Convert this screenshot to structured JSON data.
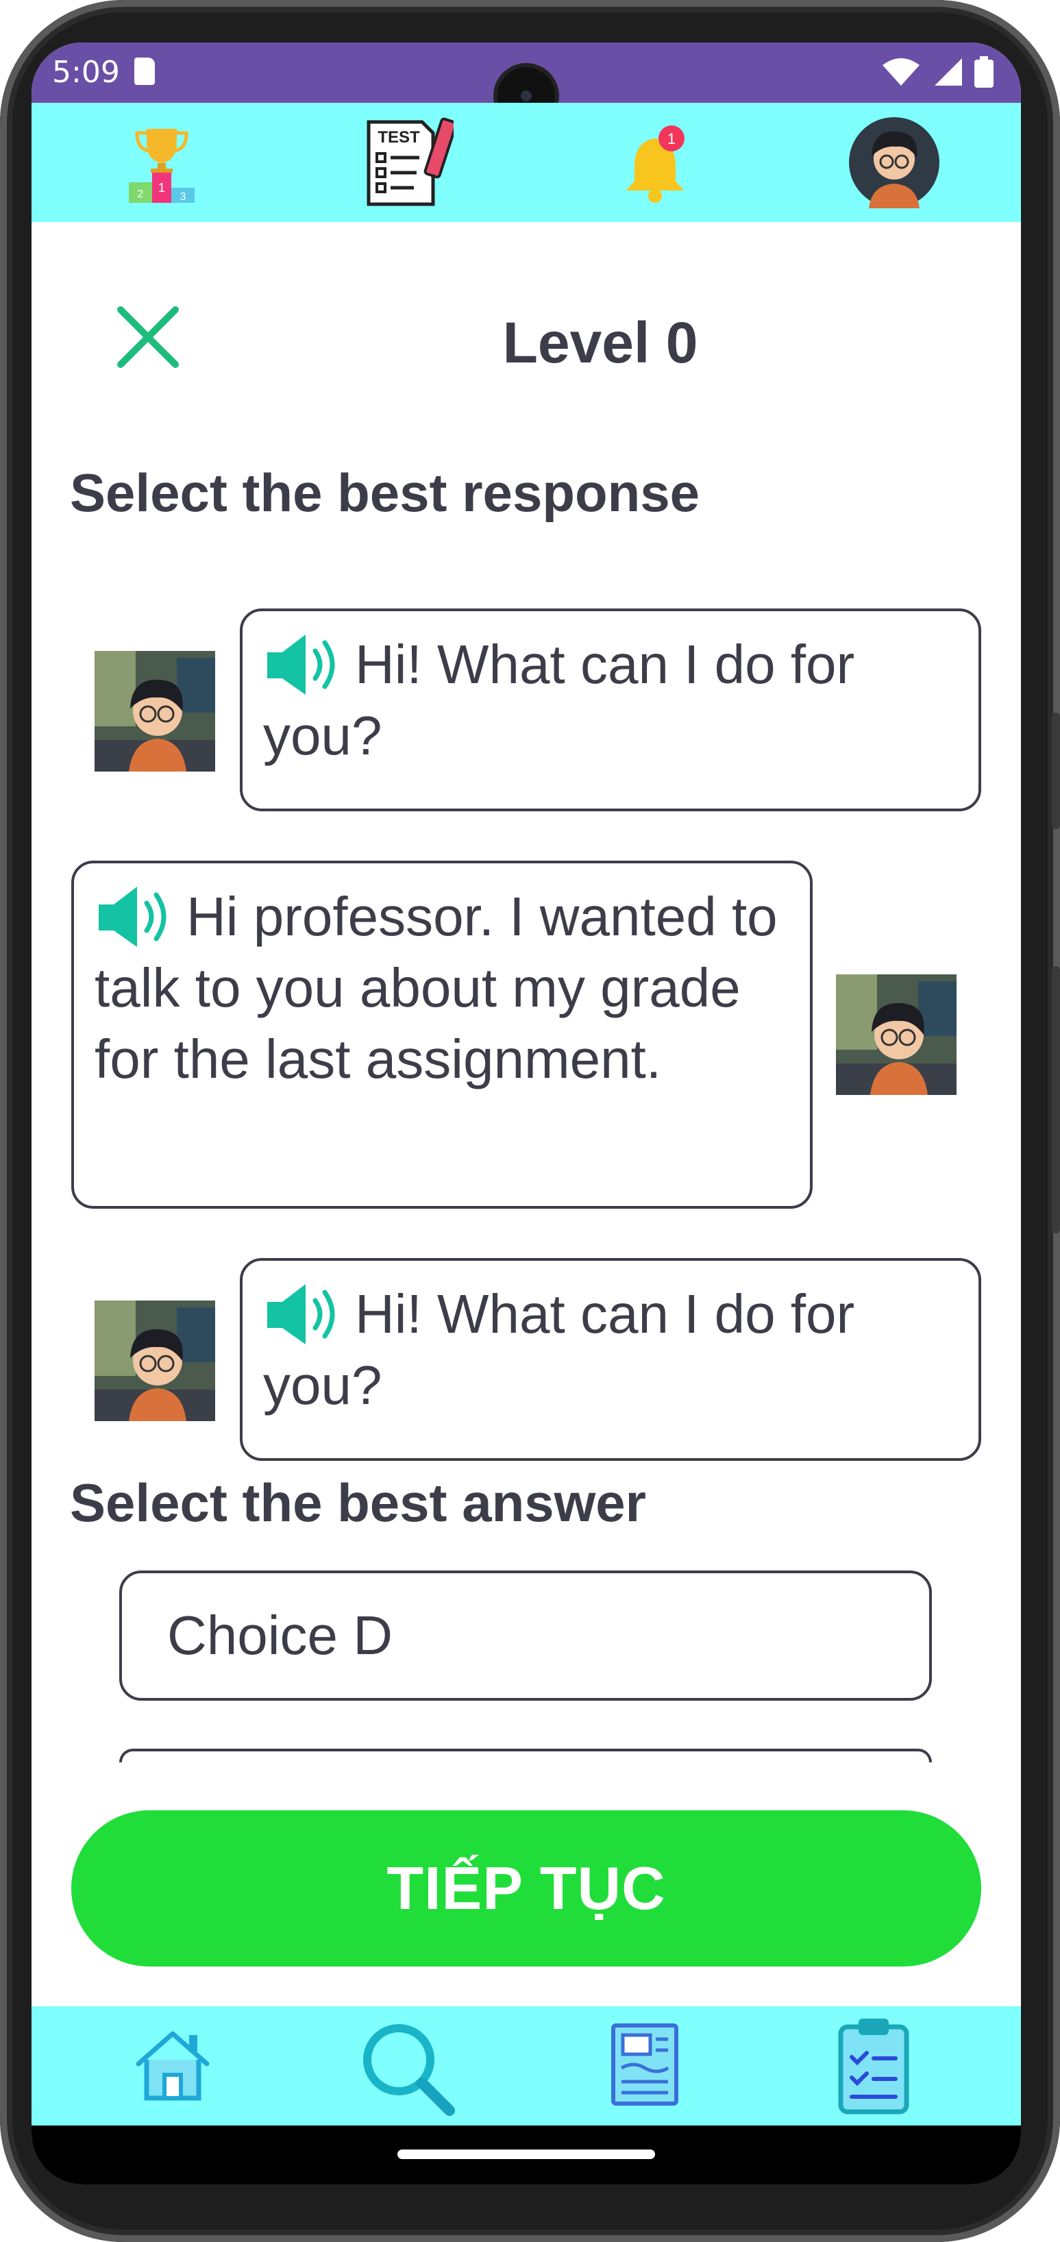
{
  "status_bar": {
    "time": "5:09",
    "icons": [
      "sim-card-icon",
      "wifi-icon",
      "signal-icon",
      "battery-icon"
    ],
    "color": "#6a4fa6"
  },
  "top_nav": {
    "items": [
      {
        "name": "leaderboard-icon"
      },
      {
        "name": "test-icon",
        "label": "TEST"
      },
      {
        "name": "notification-bell-icon",
        "badge": "1"
      },
      {
        "name": "profile-avatar"
      }
    ],
    "color": "#80ffff"
  },
  "header": {
    "title": "Level 0",
    "close_icon": "close-icon",
    "close_color": "#1ebc7c"
  },
  "question": {
    "prompt": "Select the best response",
    "messages": [
      {
        "side": "left",
        "text": "Hi! What can I do for you?"
      },
      {
        "side": "right",
        "text": "Hi professor. I wanted to talk to you about my grade for the last assignment."
      },
      {
        "side": "left",
        "text": "Hi! What can I do for you?"
      }
    ]
  },
  "answers": {
    "prompt": "Select the best answer",
    "choices": [
      "Choice D"
    ]
  },
  "continue_button": {
    "label": "TIẾP TỤC",
    "color": "#20dd3a"
  },
  "bottom_nav": {
    "items": [
      "home-icon",
      "search-icon",
      "document-icon",
      "clipboard-checklist-icon"
    ]
  }
}
